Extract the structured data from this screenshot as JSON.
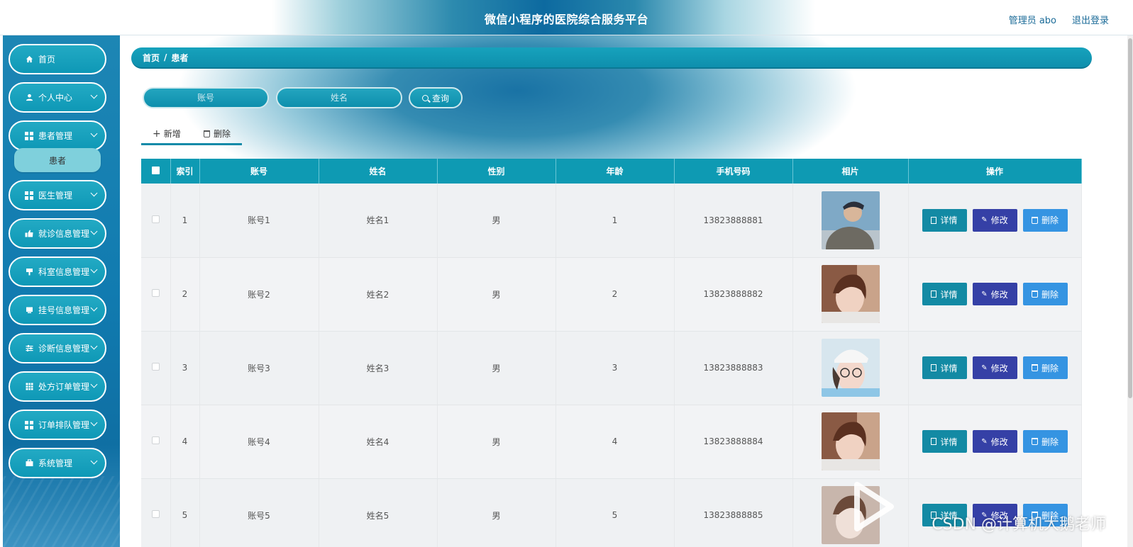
{
  "header": {
    "title": "微信小程序的医院综合服务平台",
    "user": "管理员 abo",
    "logout": "退出登录"
  },
  "sidebar": {
    "items": [
      {
        "label": "首页",
        "icon": "home-icon"
      },
      {
        "label": "个人中心",
        "icon": "user-icon"
      },
      {
        "label": "患者管理",
        "icon": "grid-icon"
      },
      {
        "label": "医生管理",
        "icon": "grid-icon"
      },
      {
        "label": "就诊信息管理",
        "icon": "thumb-icon"
      },
      {
        "label": "科室信息管理",
        "icon": "flag-icon"
      },
      {
        "label": "挂号信息管理",
        "icon": "card-icon"
      },
      {
        "label": "诊断信息管理",
        "icon": "sliders-icon"
      },
      {
        "label": "处方订单管理",
        "icon": "table-icon"
      },
      {
        "label": "订单排队管理",
        "icon": "grid-icon"
      },
      {
        "label": "系统管理",
        "icon": "briefcase-icon"
      }
    ],
    "sub_item": "患者"
  },
  "breadcrumb": {
    "home": "首页",
    "sep": "/",
    "current": "患者"
  },
  "search": {
    "account_placeholder": "账号",
    "name_placeholder": "姓名",
    "query_label": "查询"
  },
  "actions": {
    "add_label": "新增",
    "delete_label": "删除"
  },
  "table": {
    "columns": [
      "索引",
      "账号",
      "姓名",
      "性别",
      "年龄",
      "手机号码",
      "相片",
      "操作"
    ],
    "rows": [
      {
        "index": "1",
        "account": "账号1",
        "name": "姓名1",
        "gender": "男",
        "age": "1",
        "phone": "13823888881"
      },
      {
        "index": "2",
        "account": "账号2",
        "name": "姓名2",
        "gender": "男",
        "age": "2",
        "phone": "13823888882"
      },
      {
        "index": "3",
        "account": "账号3",
        "name": "姓名3",
        "gender": "男",
        "age": "3",
        "phone": "13823888883"
      },
      {
        "index": "4",
        "account": "账号4",
        "name": "姓名4",
        "gender": "男",
        "age": "4",
        "phone": "13823888884"
      },
      {
        "index": "5",
        "account": "账号5",
        "name": "姓名5",
        "gender": "男",
        "age": "5",
        "phone": "13823888885"
      }
    ],
    "op_detail": "详情",
    "op_edit": "修改",
    "op_delete": "删除"
  },
  "watermark": "CSDN @计算机大鹅老师",
  "colors": {
    "accent": "#0e9ab3",
    "sidebar": "#117bb0",
    "edit": "#3540a6",
    "delete": "#3594e2"
  }
}
